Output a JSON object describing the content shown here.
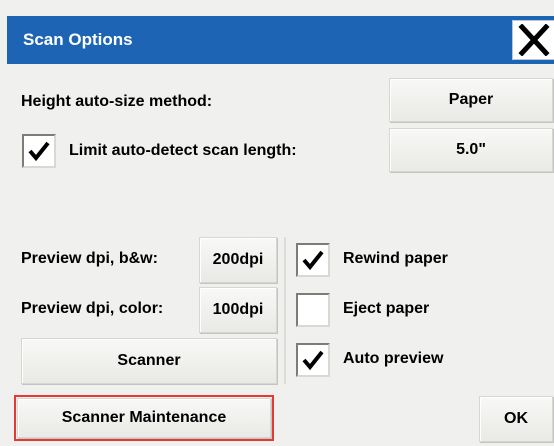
{
  "dialog": {
    "title": "Scan Options",
    "close_icon": "close-icon"
  },
  "height_method": {
    "label": "Height auto-size method:",
    "value": "Paper"
  },
  "limit_scan": {
    "label": "Limit auto-detect scan length:",
    "checked": true,
    "value": "5.0\""
  },
  "preview_bw": {
    "label": "Preview dpi, b&w:",
    "value": "200dpi"
  },
  "preview_color": {
    "label": "Preview dpi, color:",
    "value": "100dpi"
  },
  "options": {
    "rewind_paper": {
      "label": "Rewind paper",
      "checked": true
    },
    "eject_paper": {
      "label": "Eject paper",
      "checked": false
    },
    "auto_preview": {
      "label": "Auto preview",
      "checked": true
    }
  },
  "buttons": {
    "scanner": "Scanner",
    "scanner_maintenance": "Scanner Maintenance",
    "ok": "OK"
  },
  "colors": {
    "titlebar": "#1e64b4",
    "highlight": "#e53935"
  }
}
